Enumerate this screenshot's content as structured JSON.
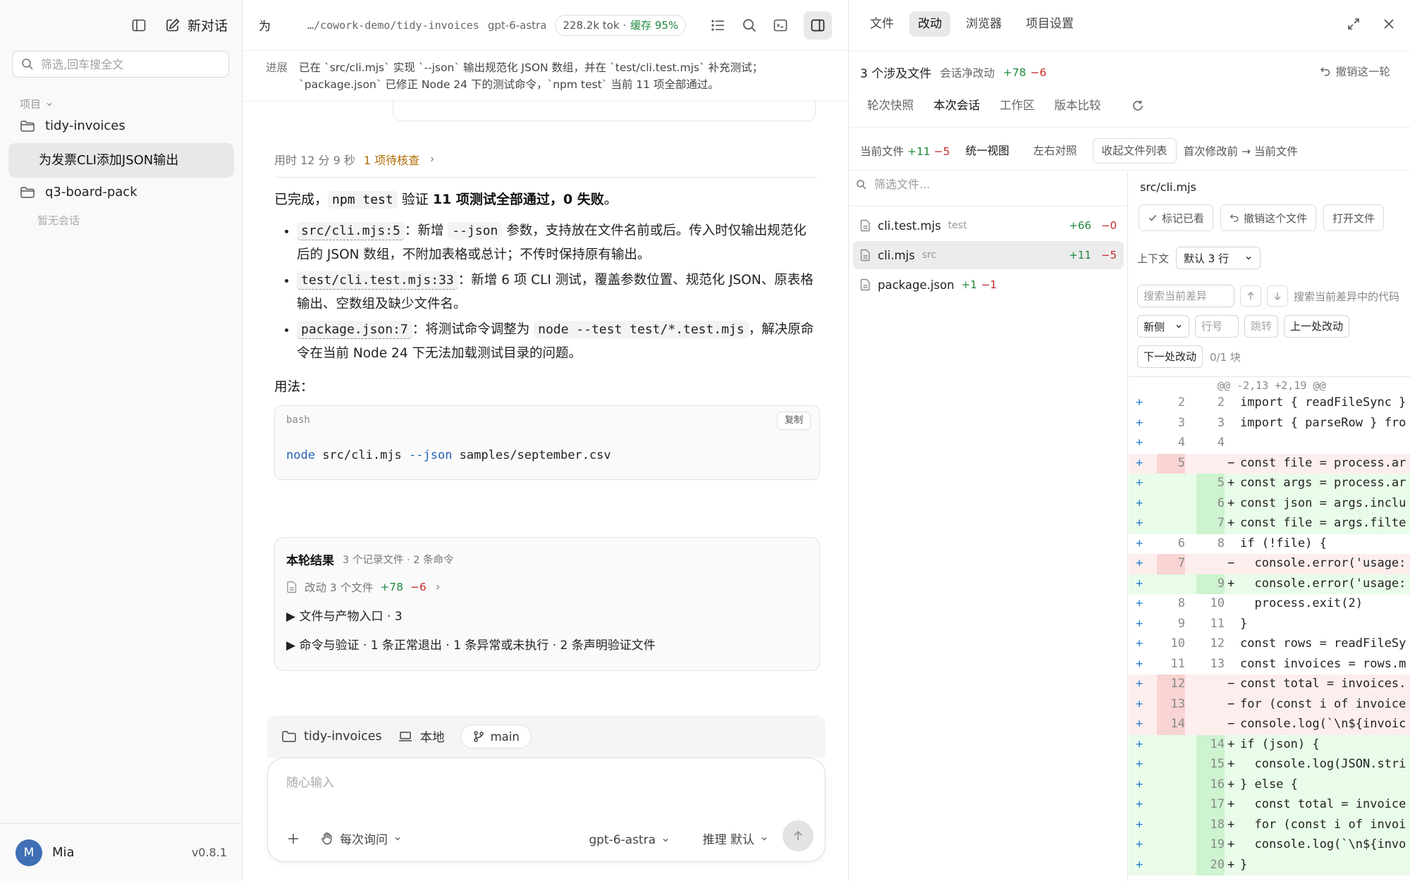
{
  "sidebar": {
    "new_chat": "新对话",
    "search_placeholder": "筛选,回车搜全文",
    "section_label": "项目",
    "projects": [
      {
        "name": "tidy-invoices"
      },
      {
        "name": "q3-board-pack"
      }
    ],
    "active_chat": "为发票CLI添加JSON输出",
    "empty_label": "暂无会话",
    "user": {
      "initial": "M",
      "name": "Mia",
      "version": "v0.8.1"
    }
  },
  "topbar": {
    "title": "为",
    "path": "…/cowork-demo/tidy-invoices",
    "model": "gpt-6-astra",
    "tokens": "228.2k tok ·",
    "cache": "缓存 95%"
  },
  "progress": {
    "label": "进展",
    "line1": "已在 `src/cli.mjs` 实现 `--json` 输出规范化 JSON 数组，并在 `test/cli.test.mjs` 补充测试；",
    "line2": "`package.json` 已修正 Node 24 下的测试命令，`npm test` 当前 11 项全部通过。"
  },
  "message": {
    "elapsed": "用时 12 分 9 秒",
    "checks": "1 项待核查",
    "done_prefix": "已完成，",
    "done_code": "npm test",
    "done_mid": " 验证 ",
    "done_bold": "11 项测试全部通过，0 失败",
    "done_suffix": "。",
    "bullets": [
      {
        "code": "src/cli.mjs:5",
        "text": "：新增 ",
        "code2": "--json",
        "text2": " 参数，支持放在文件名前或后。传入时仅输出规范化后的 JSON 数组，不附加表格或总计；不传时保持原有输出。"
      },
      {
        "code": "test/cli.test.mjs:33",
        "text": "：新增 6 项 CLI 测试，覆盖参数位置、规范化 JSON、原表格输出、空数组及缺少文件名。"
      },
      {
        "code": "package.json:7",
        "text": "：将测试命令调整为 ",
        "code2": "node --test test/*.test.mjs",
        "text2": "，解决原命令在当前 Node 24 下无法加载测试目录的问题。"
      }
    ],
    "usage_label": "用法：",
    "code_lang": "bash",
    "copy_label": "复制",
    "code_cmd": "node",
    "code_rest1": " src/cli.mjs ",
    "code_flag": "--json",
    "code_rest2": " samples/september.csv"
  },
  "result": {
    "title": "本轮结果",
    "subtitle": "3 个记录文件 · 2 条命令",
    "change_label": "改动 3 个文件",
    "add": "+78",
    "del": "−6",
    "row1": "▶ 文件与产物入口 · 3",
    "row2": "▶ 命令与验证 · 1 条正常退出 · 1 条异常或未执行 · 2 条声明验证文件"
  },
  "composer": {
    "project": "tidy-invoices",
    "location": "本地",
    "branch": "main",
    "placeholder": "随心输入",
    "approval": "每次询问",
    "model": "gpt-6-astra",
    "reasoning": "推理 默认"
  },
  "right": {
    "tabs": [
      "文件",
      "改动",
      "浏览器",
      "项目设置"
    ],
    "summary": "3 个涉及文件",
    "net_label": "会话净改动",
    "net_add": "+78",
    "net_del": "−6",
    "undo_round": "撤销这一轮",
    "subtabs": [
      "轮次快照",
      "本次会话",
      "工作区",
      "版本比较"
    ],
    "current_file_label": "当前文件",
    "current_add": "+11",
    "current_del": "−5",
    "view_unified": "统一视图",
    "view_split": "左右对照",
    "collapse_btn": "收起文件列表",
    "compare_label": "首次修改前 → 当前文件",
    "file_filter_placeholder": "筛选文件...",
    "files": [
      {
        "name": "cli.test.mjs",
        "tag": "test",
        "add": "+66",
        "del": "−0"
      },
      {
        "name": "cli.mjs",
        "tag": "src",
        "add": "+11",
        "del": "−5"
      },
      {
        "name": "package.json",
        "tag": "",
        "add": "+1",
        "del": "−1"
      }
    ],
    "diff": {
      "file": "src/cli.mjs",
      "mark_seen": "标记已看",
      "undo_file": "撤销这个文件",
      "open_file": "打开文件",
      "context_label": "上下文",
      "context_value": "默认 3 行",
      "search_placeholder": "搜索当前差异",
      "search_code": "搜索当前差异中的代码",
      "side": "新侧",
      "line_placeholder": "行号",
      "jump": "跳转",
      "prev_change": "上一处改动",
      "next_change": "下一处改动",
      "block_count": "0/1 块",
      "hunk": "@@ -2,13 +2,19 @@",
      "lines": [
        {
          "t": "c",
          "o": "2",
          "n": "2",
          "s": " ",
          "x": "import { readFileSync }"
        },
        {
          "t": "c",
          "o": "3",
          "n": "3",
          "s": " ",
          "x": "import { parseRow } fro"
        },
        {
          "t": "c",
          "o": "4",
          "n": "4",
          "s": " ",
          "x": ""
        },
        {
          "t": "r",
          "o": "5",
          "n": "",
          "s": "−",
          "x": "const file = process.ar"
        },
        {
          "t": "a",
          "o": "",
          "n": "5",
          "s": "+",
          "x": "const args = process.ar"
        },
        {
          "t": "a",
          "o": "",
          "n": "6",
          "s": "+",
          "x": "const json = args.inclu"
        },
        {
          "t": "a",
          "o": "",
          "n": "7",
          "s": "+",
          "x": "const file = args.filte"
        },
        {
          "t": "c",
          "o": "6",
          "n": "8",
          "s": " ",
          "x": "if (!file) {"
        },
        {
          "t": "r",
          "o": "7",
          "n": "",
          "s": "−",
          "x": "  console.error('usage:"
        },
        {
          "t": "a",
          "o": "",
          "n": "9",
          "s": "+",
          "x": "  console.error('usage:"
        },
        {
          "t": "c",
          "o": "8",
          "n": "10",
          "s": " ",
          "x": "  process.exit(2)"
        },
        {
          "t": "c",
          "o": "9",
          "n": "11",
          "s": " ",
          "x": "}"
        },
        {
          "t": "c",
          "o": "10",
          "n": "12",
          "s": " ",
          "x": "const rows = readFileSy"
        },
        {
          "t": "c",
          "o": "11",
          "n": "13",
          "s": " ",
          "x": "const invoices = rows.m"
        },
        {
          "t": "r",
          "o": "12",
          "n": "",
          "s": "−",
          "x": "const total = invoices."
        },
        {
          "t": "r",
          "o": "13",
          "n": "",
          "s": "−",
          "x": "for (const i of invoice"
        },
        {
          "t": "r",
          "o": "14",
          "n": "",
          "s": "−",
          "x": "console.log(`\\n${invoic"
        },
        {
          "t": "a",
          "o": "",
          "n": "14",
          "s": "+",
          "x": "if (json) {"
        },
        {
          "t": "a",
          "o": "",
          "n": "15",
          "s": "+",
          "x": "  console.log(JSON.stri"
        },
        {
          "t": "a",
          "o": "",
          "n": "16",
          "s": "+",
          "x": "} else {"
        },
        {
          "t": "a",
          "o": "",
          "n": "17",
          "s": "+",
          "x": "  const total = invoice"
        },
        {
          "t": "a",
          "o": "",
          "n": "18",
          "s": "+",
          "x": "  for (const i of invoi"
        },
        {
          "t": "a",
          "o": "",
          "n": "19",
          "s": "+",
          "x": "  console.log(`\\n${invo"
        },
        {
          "t": "a",
          "o": "",
          "n": "20",
          "s": "+",
          "x": "}"
        }
      ]
    }
  }
}
